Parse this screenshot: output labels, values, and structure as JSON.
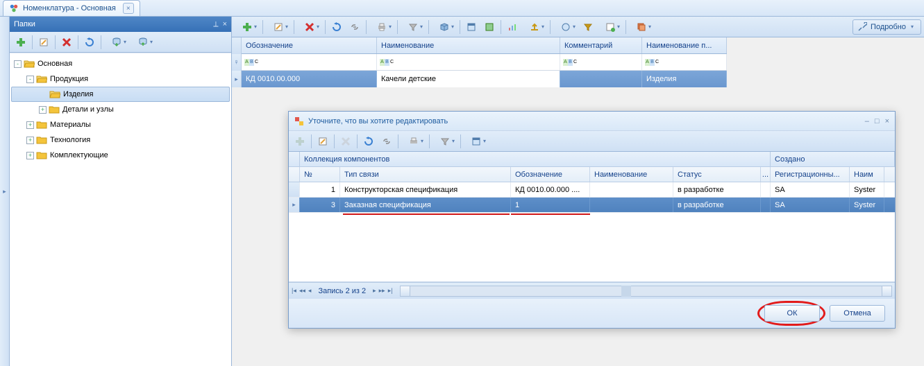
{
  "tab": {
    "title": "Номенклатура - Основная"
  },
  "folders_panel": {
    "title": "Папки"
  },
  "tree": [
    {
      "label": "Основная",
      "depth": 0,
      "exp": "-",
      "open": true
    },
    {
      "label": "Продукция",
      "depth": 1,
      "exp": "-",
      "open": true
    },
    {
      "label": "Изделия",
      "depth": 2,
      "exp": "",
      "open": true,
      "selected": true
    },
    {
      "label": "Детали и узлы",
      "depth": 2,
      "exp": "+",
      "open": false
    },
    {
      "label": "Материалы",
      "depth": 1,
      "exp": "+",
      "open": false
    },
    {
      "label": "Технология",
      "depth": 1,
      "exp": "+",
      "open": false
    },
    {
      "label": "Комплектующие",
      "depth": 1,
      "exp": "+",
      "open": false
    }
  ],
  "grid": {
    "headers": {
      "c1": "Обозначение",
      "c2": "Наименование",
      "c3": "Комментарий",
      "c4": "Наименование п..."
    },
    "row": {
      "c1": "КД 0010.00.000",
      "c2": "Качели детские",
      "c3": "",
      "c4": "Изделия"
    }
  },
  "details_button": "Подробно",
  "dialog": {
    "title": "Уточните, что вы хотите редактировать",
    "group_headers": {
      "g1": "Коллекция компонентов",
      "g2": "Создано"
    },
    "col_headers": {
      "no": "№",
      "type": "Тип связи",
      "oboz": "Обозначение",
      "naim": "Наименование",
      "status": "Статус",
      "dots": "...",
      "reg": "Регистрационны...",
      "naim2": "Наим"
    },
    "rows": [
      {
        "no": "1",
        "type": "Конструкторская спецификация",
        "oboz": "КД 0010.00.000 ....",
        "naim": "",
        "status": "в разработке",
        "reg": "SA",
        "naim2": "Syster"
      },
      {
        "no": "3",
        "type": "Заказная спецификация",
        "oboz": "1",
        "naim": "",
        "status": "в разработке",
        "reg": "SA",
        "naim2": "Syster",
        "selected": true
      }
    ],
    "pager": "Запись 2 из 2",
    "ok": "ОК",
    "cancel": "Отмена"
  }
}
